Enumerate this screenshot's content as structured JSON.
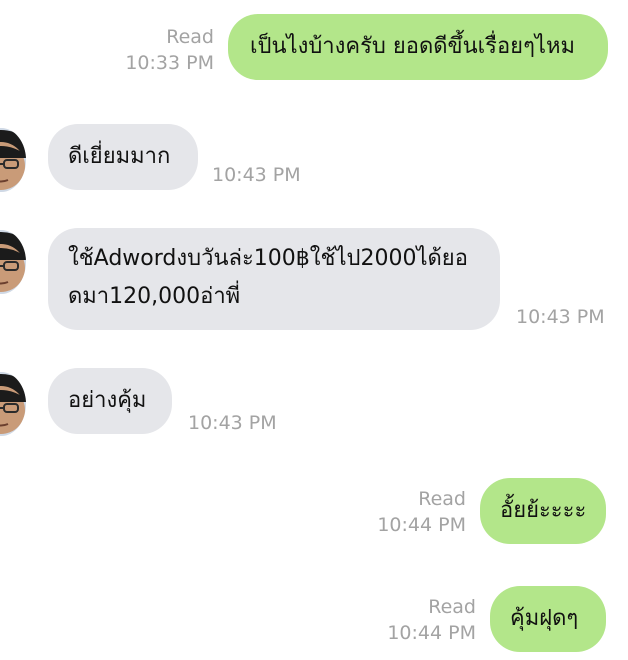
{
  "messages": [
    {
      "direction": "out",
      "status": "Read",
      "time": "10:33 PM",
      "text": "เป็นไงบ้างครับ ยอดดีขึ้นเรื่อยๆไหม"
    },
    {
      "direction": "in",
      "time": "10:43 PM",
      "text": "ดีเยี่ยมมาก"
    },
    {
      "direction": "in",
      "time": "10:43 PM",
      "text_line1": "ใช้Adwordงบวันล่ะ100฿ใช้ไป2000ได้ยอ",
      "text_line2": "ดมา120,000อ่าพี่"
    },
    {
      "direction": "in",
      "time": "10:43 PM",
      "text": "อย่างคุ้ม"
    },
    {
      "direction": "out",
      "status": "Read",
      "time": "10:44 PM",
      "text": "อั้ยย้ะะะะ"
    },
    {
      "direction": "out",
      "status": "Read",
      "time": "10:44 PM",
      "text": "คุ้มฝุดๆ"
    }
  ],
  "colors": {
    "outgoing_bubble": "#b3e68a",
    "incoming_bubble": "#e5e6ea",
    "meta_text": "#a3a3a3"
  },
  "icons": {
    "avatar": "contact-avatar"
  }
}
